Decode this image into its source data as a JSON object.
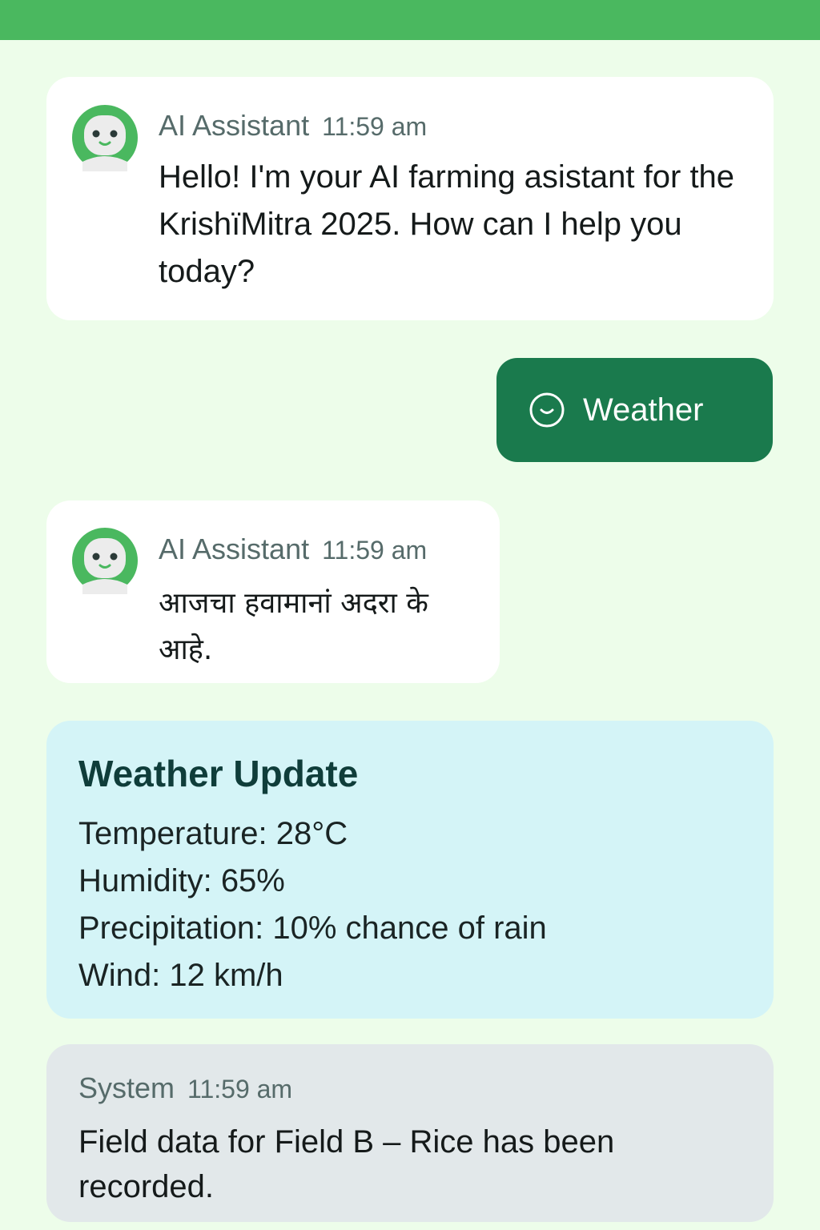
{
  "colors": {
    "top_bar": "#4ab85f",
    "background": "#edfdea",
    "accent_button": "#1a7a4d",
    "avatar_ring": "#4ab85f",
    "weather_card": "#d4f4f7",
    "system_card": "#e2e8ea"
  },
  "messages": [
    {
      "sender": "AI Assistant",
      "time": "11:59 am",
      "text": "Hello! I'm your AI farming asistant for the KrishïMitra 2025. How can I help you today?",
      "icon": "robot-avatar-icon"
    },
    {
      "sender": "AI Assistant",
      "time": "11:59 am",
      "text": "आजचा हवामानां अदरा के आहे.",
      "icon": "robot-avatar-icon"
    }
  ],
  "quick_reply": {
    "label": "Weather",
    "icon": "clock-icon"
  },
  "weather_update": {
    "title": "Weather Update",
    "temperature": "Temperature: 28°C",
    "humidity": "Humidity: 65%",
    "precipitation": "Precipitation: 10% chance of rain",
    "wind": "Wind: 12 km/h"
  },
  "system_message": {
    "sender": "System",
    "time": "11:59 am",
    "text": "Field data for Field B – Rice has been recorded."
  }
}
